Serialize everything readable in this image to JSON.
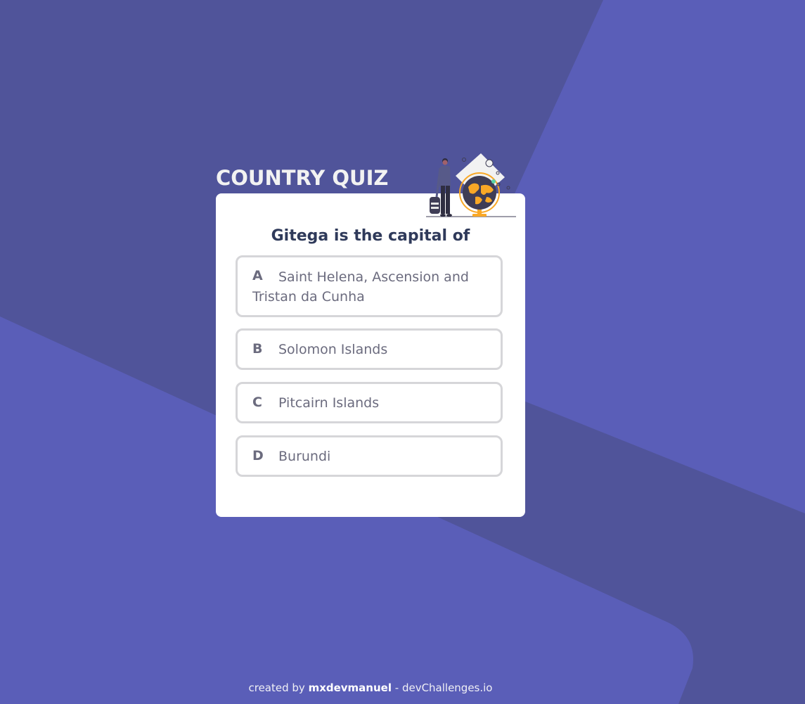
{
  "app": {
    "title": "COUNTRY QUIZ"
  },
  "question": {
    "text": "Gitega is the capital of"
  },
  "options": [
    {
      "letter": "A",
      "label": "Saint Helena, Ascension and Tristan da Cunha"
    },
    {
      "letter": "B",
      "label": "Solomon Islands"
    },
    {
      "letter": "C",
      "label": "Pitcairn Islands"
    },
    {
      "letter": "D",
      "label": "Burundi"
    }
  ],
  "footer": {
    "prefix": "created by ",
    "author": "mxdevmanuel",
    "separator": " - ",
    "site": "devChallenges.io"
  },
  "colors": {
    "background": "#5a5eb8",
    "background_shape": "#50549a",
    "card": "#ffffff",
    "question_text": "#2f3a5a",
    "option_text": "#6b6b7e",
    "option_border": "#d6d6d9",
    "illustration_accent": "#f9a826"
  },
  "icons": {
    "illustration": "traveler-with-globe-illustration"
  }
}
